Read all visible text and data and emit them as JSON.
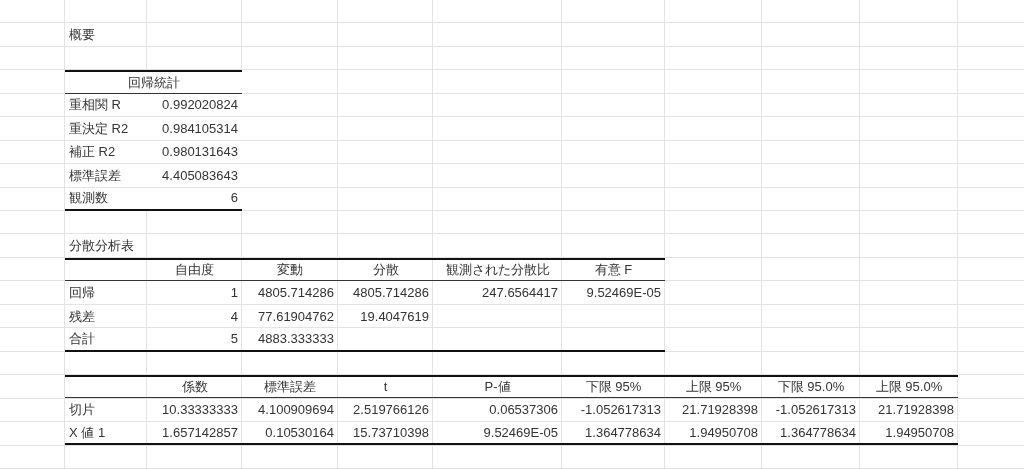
{
  "summary_title": "概要",
  "regression_stats": {
    "title": "回帰統計",
    "rows": [
      {
        "label": "重相関 R",
        "value": "0.992020824"
      },
      {
        "label": "重決定 R2",
        "value": "0.984105314"
      },
      {
        "label": "補正 R2",
        "value": "0.980131643"
      },
      {
        "label": "標準誤差",
        "value": "4.405083643"
      },
      {
        "label": "観測数",
        "value": "6"
      }
    ]
  },
  "anova": {
    "title": "分散分析表",
    "columns": [
      "自由度",
      "変動",
      "分散",
      "観測された分散比",
      "有意 F"
    ],
    "rows": [
      {
        "label": "回帰",
        "cells": [
          "1",
          "4805.714286",
          "4805.714286",
          "247.6564417",
          "9.52469E-05"
        ]
      },
      {
        "label": "残差",
        "cells": [
          "4",
          "77.61904762",
          "19.4047619"
        ]
      },
      {
        "label": "合計",
        "cells": [
          "5",
          "4883.333333"
        ]
      }
    ]
  },
  "coefficients": {
    "columns": [
      "係数",
      "標準誤差",
      "t",
      "P-値",
      "下限 95%",
      "上限 95%",
      "下限 95.0%",
      "上限 95.0%"
    ],
    "rows": [
      {
        "label": "切片",
        "cells": [
          "10.33333333",
          "4.100909694",
          "2.519766126",
          "0.06537306",
          "-1.052617313",
          "21.71928398",
          "-1.052617313",
          "21.71928398"
        ]
      },
      {
        "label": "X 値 1",
        "cells": [
          "1.657142857",
          "0.10530164",
          "15.73710398",
          "9.52469E-05",
          "1.364778634",
          "1.94950708",
          "1.364778634",
          "1.94950708"
        ]
      }
    ]
  }
}
